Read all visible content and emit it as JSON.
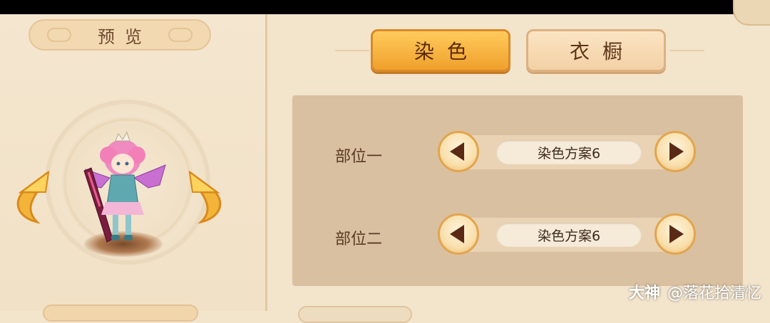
{
  "left_panel": {
    "title": "预览"
  },
  "tabs": [
    {
      "label": "染色",
      "active": true
    },
    {
      "label": "衣橱",
      "active": false
    }
  ],
  "parts": [
    {
      "label": "部位一",
      "value": "染色方案6"
    },
    {
      "label": "部位二",
      "value": "染色方案6"
    }
  ],
  "watermark": {
    "brand": "大神",
    "handle": "@落花拾清忆"
  },
  "colors": {
    "accent": "#f0a02c",
    "panel_bg": "#d9c0a0",
    "page_bg": "#f3e4cc"
  }
}
